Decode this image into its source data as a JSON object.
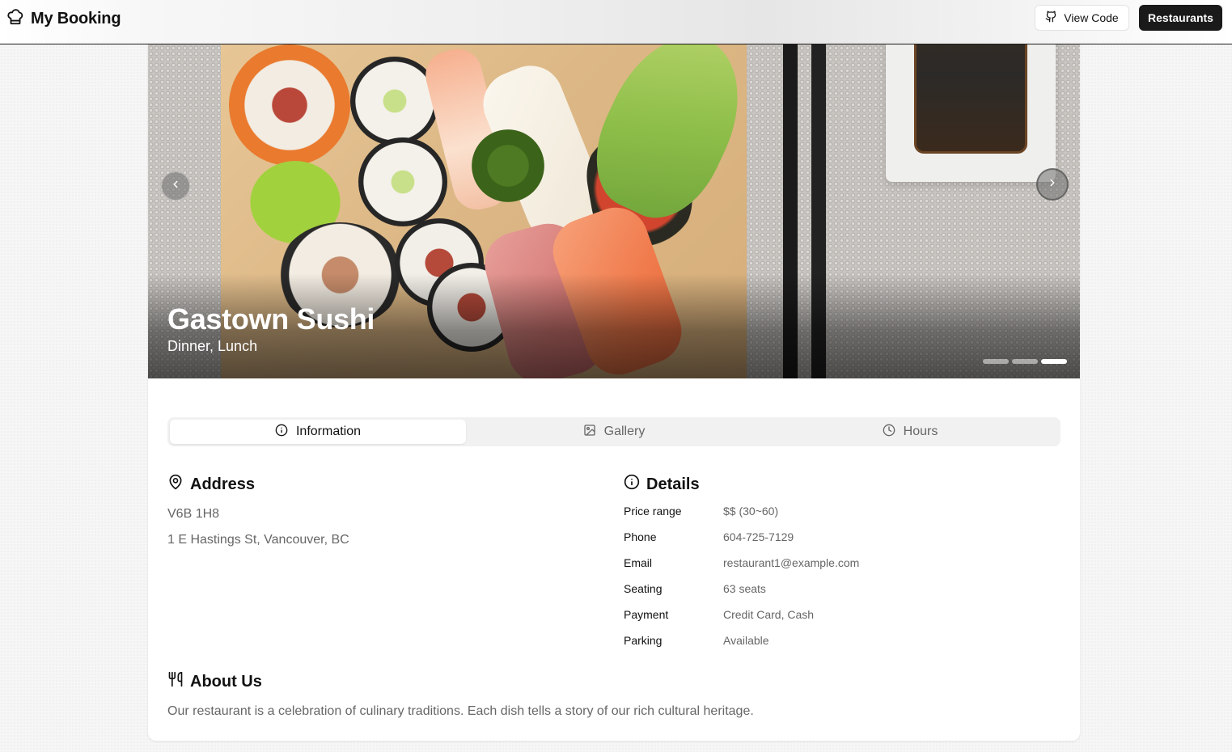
{
  "app": {
    "brand": "My Booking"
  },
  "header": {
    "view_code_label": "View Code",
    "restaurants_label": "Restaurants"
  },
  "hero": {
    "title": "Gastown Sushi",
    "subtitle": "Dinner, Lunch",
    "slide_count": 3,
    "active_slide": 3
  },
  "tabs": [
    {
      "label": "Information",
      "icon": "info-icon",
      "active": true
    },
    {
      "label": "Gallery",
      "icon": "image-icon",
      "active": false
    },
    {
      "label": "Hours",
      "icon": "clock-icon",
      "active": false
    }
  ],
  "address": {
    "heading": "Address",
    "postal": "V6B 1H8",
    "street": "1 E Hastings St, Vancouver, BC"
  },
  "details": {
    "heading": "Details",
    "rows": [
      {
        "label": "Price range",
        "value": "$$ (30~60)"
      },
      {
        "label": "Phone",
        "value": "604-725-7129"
      },
      {
        "label": "Email",
        "value": "restaurant1@example.com"
      },
      {
        "label": "Seating",
        "value": "63 seats"
      },
      {
        "label": "Payment",
        "value": "Credit Card, Cash"
      },
      {
        "label": "Parking",
        "value": "Available"
      }
    ]
  },
  "about": {
    "heading": "About Us",
    "text": "Our restaurant is a celebration of culinary traditions. Each dish tells a story of our rich cultural heritage."
  },
  "colors": {
    "primary": "#1a1a1a",
    "muted_text": "#666666",
    "tab_bg": "#f1f1f1"
  }
}
